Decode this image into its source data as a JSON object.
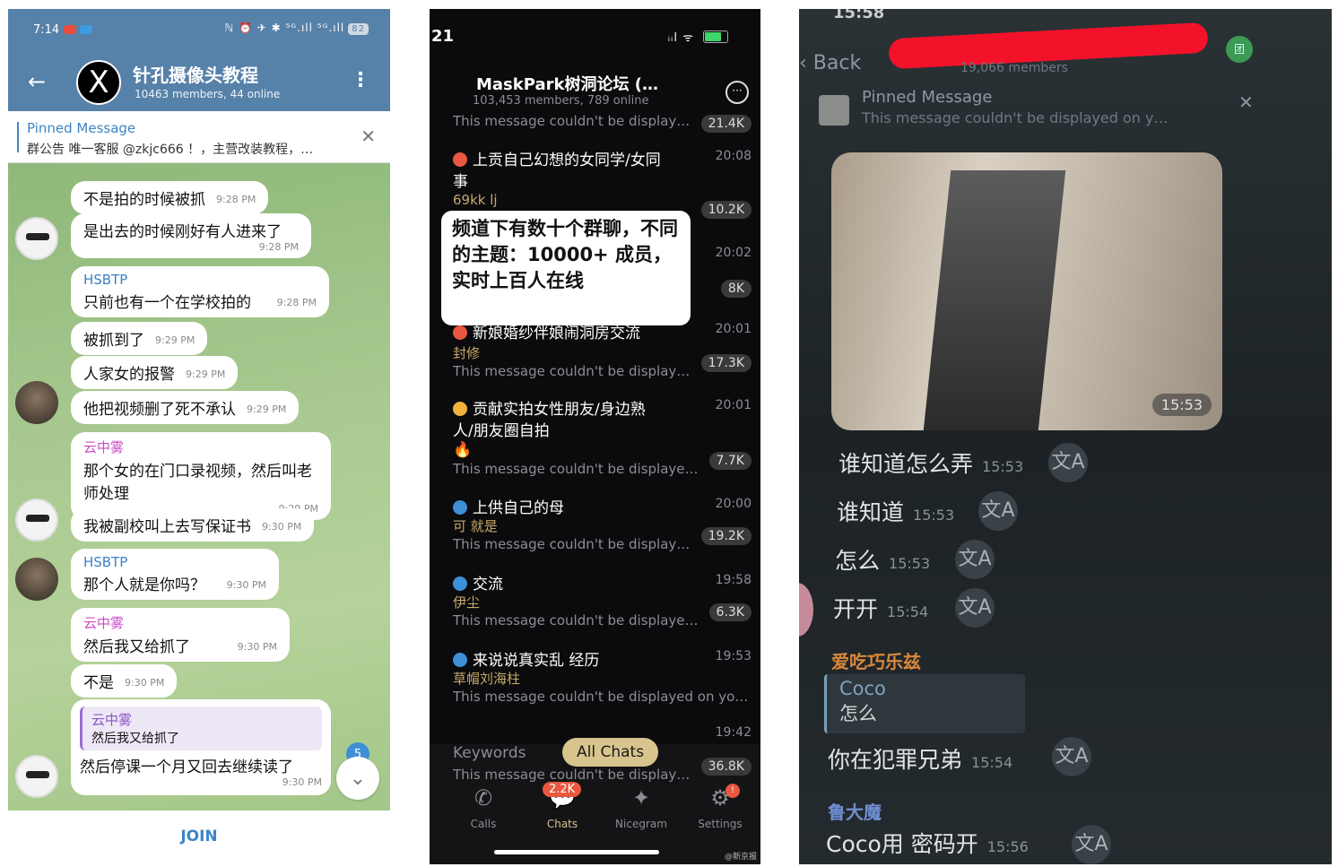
{
  "panel1": {
    "status": {
      "time": "7:14",
      "signal": "ℕ ⏰ ✈ ✱ ⁵ᴳ.ıll ⁵ᴳ.ıll",
      "battery": "82"
    },
    "header": {
      "title": "针孔摄像头教程",
      "subtitle": "10463 members, 44 online",
      "back_icon": "←",
      "menu_icon": "⋮",
      "avatar_glyph": "X"
    },
    "pinned": {
      "title": "Pinned Message",
      "text": "群公告 唯一客服 @zkjc666 ！，主营改装教程，…",
      "close": "✕"
    },
    "messages": [
      {
        "text": "不是拍的时候被抓",
        "time": "9:28 PM"
      },
      {
        "text": "是出去的时候刚好有人进来了",
        "time": "9:28 PM"
      },
      {
        "name": "HSBTP",
        "text": "只前也有一个在学校拍的",
        "time": "9:28 PM"
      },
      {
        "text": "被抓到了",
        "time": "9:29 PM"
      },
      {
        "text": "人家女的报警",
        "time": "9:29 PM"
      },
      {
        "text": "他把视频删了死不承认",
        "time": "9:29 PM"
      },
      {
        "name": "云中雾",
        "text": "那个女的在门口录视频，然后叫老师处理",
        "time": "9:29 PM"
      },
      {
        "text": "我被副校叫上去写保证书",
        "time": "9:30 PM"
      },
      {
        "name": "HSBTP",
        "text": "那个人就是你吗？",
        "time": "9:30 PM"
      },
      {
        "name": "云中雾",
        "text": "然后我又给抓了",
        "time": "9:30 PM"
      },
      {
        "text": "不是",
        "time": "9:30 PM"
      },
      {
        "reply_name": "云中雾",
        "reply_text": "然后我又给抓了",
        "text": "然后停课一个月又回去继续读了",
        "time": "9:30 PM"
      }
    ],
    "unread_badge": "5",
    "scroll_icon": "⌄",
    "join_label": "JOIN"
  },
  "panel2": {
    "status": {
      "time": "21",
      "signal": "ᵢᵢl ᯤ"
    },
    "header": {
      "title": "MaskPark树洞论坛 (…",
      "subtitle": "103,453 members, 789 online",
      "more_icon": "···"
    },
    "rows": [
      {
        "line3": "This message couldn't be display…",
        "count": "21.4K"
      },
      {
        "title": "上贡自己幻想的女同学/女同",
        "title2": "事",
        "sender": "69kk lj",
        "time": "20:08",
        "count": "10.2K"
      },
      {
        "time": "20:02",
        "count": "8K"
      },
      {
        "title": "新娘婚纱伴娘闹洞房交流",
        "sender": "封修",
        "line3": "This message couldn't be display…",
        "time": "20:01",
        "count": "17.3K"
      },
      {
        "title": "贡献实拍女性朋友/身边熟",
        "title2": "人/朋友圈自拍",
        "line3": "This message couldn't be displaye…",
        "time": "20:01",
        "count": "7.7K"
      },
      {
        "title": "上供自己的母",
        "sender": "可 就是",
        "line3": "This message couldn't be display…",
        "time": "20:00",
        "count": "19.2K"
      },
      {
        "title": "交流",
        "sender": "伊尘",
        "line3": "This message couldn't be displaye…",
        "time": "19:58",
        "count": "6.3K"
      },
      {
        "title": "来说说真实乱  经历",
        "sender": "草帽刘海柱",
        "line3": "This message couldn't be displayed on yo…",
        "time": "19:53"
      },
      {
        "time": "19:42",
        "line3": "This message couldn't be display…",
        "count": "36.8K"
      }
    ],
    "overlay": "频道下有数十个群聊，不同的主题：10000+ 成员，实时上百人在线",
    "keywords": "Keywords",
    "all_chats": "All Chats",
    "tabs": [
      {
        "label": "Calls",
        "icon": "✆"
      },
      {
        "label": "Chats",
        "icon": "💬"
      },
      {
        "label": "Nicegram",
        "icon": "✦"
      },
      {
        "label": "Settings",
        "icon": "⚙"
      }
    ],
    "chats_badge": "2.2K",
    "settings_badge": "!",
    "watermark": "@新京报"
  },
  "panel3": {
    "clock": "15:58",
    "back": "‹ Back",
    "members": "19,066 members",
    "pinned_title": "Pinned Message",
    "pinned_text": "This message couldn't be displayed on y…",
    "photo_time": "15:53",
    "messages": [
      {
        "text": "谁知道怎么弄",
        "time": "15:53"
      },
      {
        "text": "谁知道",
        "time": "15:53"
      },
      {
        "text": "怎么",
        "time": "15:53"
      },
      {
        "text": "开开",
        "time": "15:54"
      },
      {
        "text": "你在犯罪兄弟",
        "time": "15:54"
      },
      {
        "text": "Coco用 密码开",
        "time": "15:56"
      }
    ],
    "sender1": "爱吃巧乐兹",
    "quote_name": "Coco",
    "quote_text": "怎么",
    "sender2": "鲁大魔",
    "translate_icon": "文A"
  }
}
